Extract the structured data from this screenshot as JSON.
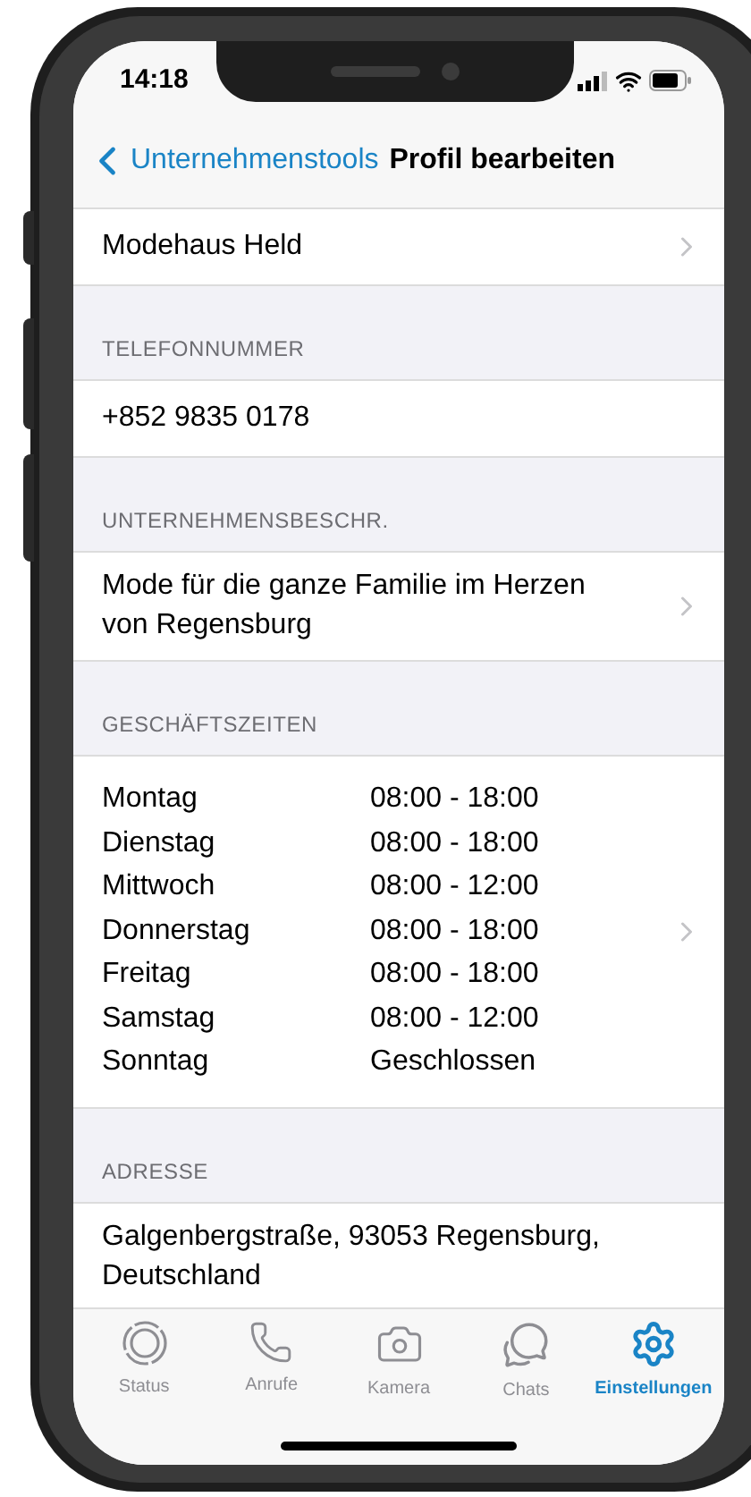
{
  "status_bar": {
    "time": "14:18"
  },
  "nav": {
    "back_label": "Unternehmenstools",
    "title": "Profil bearbeiten"
  },
  "sections": [
    {
      "kind": "value",
      "text": "Modehaus Held",
      "chevron": true
    },
    {
      "kind": "value",
      "header": "TELEFONNUMMER",
      "text": "+852 9835 0178",
      "chevron": false
    },
    {
      "kind": "value",
      "header": "UNTERNEHMENSBESCHR.",
      "text": "Mode für die ganze Familie im Herzen von Regensburg",
      "chevron": true
    },
    {
      "kind": "hours",
      "header": "GESCHÄFTSZEITEN",
      "chevron": true,
      "rows": [
        {
          "day": "Montag",
          "time": "08:00 - 18:00"
        },
        {
          "day": "Dienstag",
          "time": "08:00 - 18:00"
        },
        {
          "day": "Mittwoch",
          "time": "08:00 - 12:00"
        },
        {
          "day": "Donnerstag",
          "time": "08:00 - 18:00"
        },
        {
          "day": "Freitag",
          "time": "08:00 - 18:00"
        },
        {
          "day": "Samstag",
          "time": "08:00 - 12:00"
        },
        {
          "day": "Sonntag",
          "time": "Geschlossen"
        }
      ]
    },
    {
      "kind": "value",
      "header": "ADRESSE",
      "text": "Galgenbergstraße, 93053 Regensburg, Deutschland",
      "chevron": false
    }
  ],
  "tab_bar": [
    {
      "kind": "status",
      "label": "Status",
      "selected": false
    },
    {
      "kind": "calls",
      "label": "Anrufe",
      "selected": false
    },
    {
      "kind": "camera",
      "label": "Kamera",
      "selected": false
    },
    {
      "kind": "chats",
      "label": "Chats",
      "selected": false
    },
    {
      "kind": "settings",
      "label": "Einstellungen",
      "selected": true
    }
  ]
}
